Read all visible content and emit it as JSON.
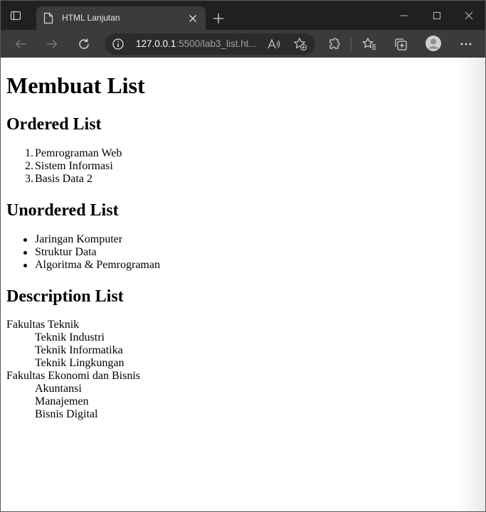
{
  "browser": {
    "tab": {
      "title": "HTML Lanjutan"
    },
    "address": {
      "host": "127.0.0.1",
      "rest": ":5500/lab3_list.ht..."
    }
  },
  "page": {
    "heading": "Membuat List",
    "ordered": {
      "heading": "Ordered List",
      "items": [
        {
          "marker": "1.",
          "label": "Pemrograman Web"
        },
        {
          "marker": "2.",
          "label": "Sistem Informasi"
        },
        {
          "marker": "3.",
          "label": "Basis Data 2"
        }
      ]
    },
    "unordered": {
      "heading": "Unordered List",
      "items": [
        "Jaringan Komputer",
        "Struktur Data",
        "Algoritma & Pemrograman"
      ]
    },
    "description": {
      "heading": "Description List",
      "groups": [
        {
          "term": "Fakultas Teknik",
          "details": [
            "Teknik Industri",
            "Teknik Informatika",
            "Teknik Lingkungan"
          ]
        },
        {
          "term": "Fakultas Ekonomi dan Bisnis",
          "details": [
            "Akuntansi",
            "Manajemen",
            "Bisnis Digital"
          ]
        }
      ]
    }
  },
  "colors": {
    "tabbar": "#202020",
    "toolbar": "#3b3b3b",
    "address_bg": "#2b2b2b",
    "url_host": "#ffffff",
    "url_rest": "#a0a0a0"
  },
  "icons": [
    "tab-actions-icon",
    "page-favicon-icon",
    "close-icon",
    "plus-icon",
    "minimize-icon",
    "maximize-icon",
    "window-close-icon",
    "back-icon",
    "forward-icon",
    "refresh-icon",
    "info-icon",
    "read-aloud-icon",
    "add-favorite-icon",
    "extensions-icon",
    "favorites-icon",
    "collections-icon",
    "profile-avatar",
    "more-icon"
  ]
}
